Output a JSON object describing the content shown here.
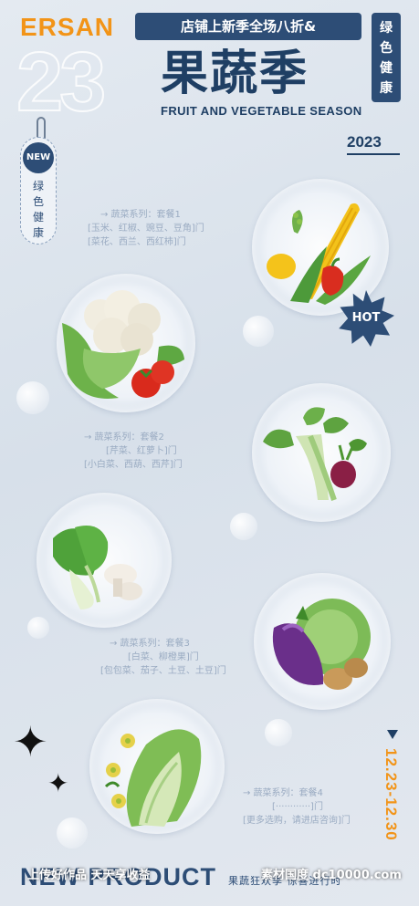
{
  "header": {
    "brand": "ERSAN",
    "big_number": "23",
    "banner": "店铺上新季全场八折&",
    "title_cn": "果蔬季",
    "title_en": "FRUIT AND VEGETABLE SEASON",
    "side_tag": "绿色健康",
    "year": "2023"
  },
  "hang_tag": {
    "badge": "NEW",
    "text": "绿色健康"
  },
  "hot_badge": "HOT",
  "sets": [
    {
      "line1": "→ 蔬菜系列：套餐1",
      "line2": "[玉米、红椒、豌豆、豆角]门",
      "line3": "[菜花、西兰、西红柿]门"
    },
    {
      "line1": "→ 蔬菜系列：套餐2",
      "line2": "[芹菜、红萝卜]门",
      "line3": "[小白菜、西葫、西芹]门"
    },
    {
      "line1": "→ 蔬菜系列：套餐3",
      "line2": "[白菜、柳橙果]门",
      "line3": "[包包菜、茄子、土豆、土豆]门"
    },
    {
      "line1": "→ 蔬菜系列：套餐4",
      "line2": "[············]门",
      "line3": "[更多选购，请进店咨询]门"
    }
  ],
  "date": "12.23-12.30",
  "footer": {
    "new_product": "NEW PRODUCT",
    "sub": "果蔬狂欢季 惊喜进行时"
  },
  "watermark": {
    "left": "上传好作品 天天享收益",
    "right": "素材国度 dc10000.com"
  },
  "icons": [
    "corn-icon",
    "cauliflower-icon",
    "celery-icon",
    "bok-choy-icon",
    "eggplant-icon",
    "cabbage-icon",
    "sparkle-icon"
  ]
}
